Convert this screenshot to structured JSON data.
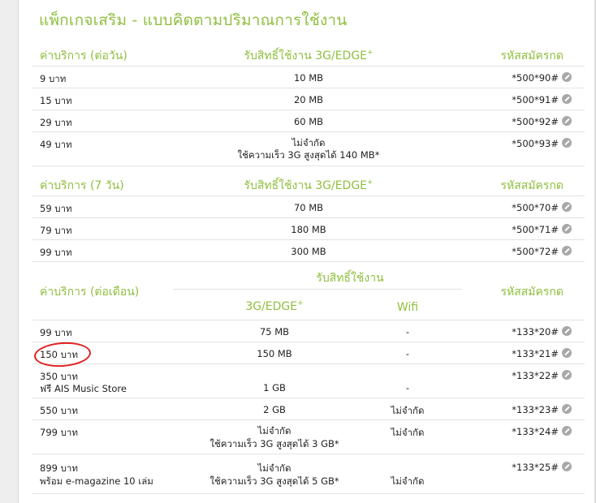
{
  "title": "แพ็กเกจเสริม - แบบคิดตามปริมาณการใช้งาน",
  "icon_name": "mobile-sms-icon",
  "accent": "#8fbf3f",
  "daily": {
    "header": {
      "price": "ค่าบริการ (ต่อวัน)",
      "right": "รับสิทธิ์ใช้งาน 3G/EDGE",
      "plus": "+",
      "code": "รหัสสมัครกด"
    },
    "rows": [
      {
        "price": "9 บาท",
        "right": "10 MB",
        "code": "*500*90#"
      },
      {
        "price": "15 บาท",
        "right": "20 MB",
        "code": "*500*91#"
      },
      {
        "price": "29 บาท",
        "right": "60 MB",
        "code": "*500*92#"
      },
      {
        "price": "49 บาท",
        "right": "ไม่จำกัด",
        "right2": "ใช้ความเร็ว 3G สูงสุดได้ 140 MB*",
        "code": "*500*93#"
      }
    ]
  },
  "weekly": {
    "header": {
      "price": "ค่าบริการ (7 วัน)",
      "right": "รับสิทธิ์ใช้งาน 3G/EDGE",
      "plus": "+",
      "code": "รหัสสมัครกด"
    },
    "rows": [
      {
        "price": "59 บาท",
        "right": "70 MB",
        "code": "*500*70#"
      },
      {
        "price": "79 บาท",
        "right": "180 MB",
        "code": "*500*71#"
      },
      {
        "price": "99 บาท",
        "right": "300 MB",
        "code": "*500*72#"
      }
    ]
  },
  "monthly": {
    "header": {
      "price": "ค่าบริการ (ต่อเดือน)",
      "right": "รับสิทธิ์ใช้งาน",
      "sub_3g": "3G/EDGE",
      "plus": "+",
      "sub_wifi": "Wifi",
      "code": "รหัสสมัครกด"
    },
    "rows": [
      {
        "price": "99 บาท",
        "rig": "75 MB",
        "wifi": "-",
        "code": "*133*20#"
      },
      {
        "price": "150 บาท",
        "rig": "150 MB",
        "wifi": "-",
        "code": "*133*21#"
      },
      {
        "price": "350 บาท",
        "price2": "ฟรี AIS Music Store",
        "rig": "1 GB",
        "wifi": "-",
        "code": "*133*22#"
      },
      {
        "price": "550 บาท",
        "rig": "2 GB",
        "wifi": "ไม่จำกัด",
        "code": "*133*23#"
      },
      {
        "price": "799 บาท",
        "rig": "ไม่จำกัด",
        "rig2": "ใช้ความเร็ว 3G สูงสุดได้ 3 GB*",
        "wifi": "ไม่จำกัด",
        "code": "*133*24#"
      },
      {
        "price": "899 บาท",
        "price2": "พร้อม e-magazine 10 เล่ม",
        "rig": "ไม่จำกัด",
        "rig2": "ใช้ความเร็ว 3G สูงสุดได้ 5 GB*",
        "wifi": "ไม่จำกัด",
        "code": "*133*25#"
      }
    ]
  }
}
